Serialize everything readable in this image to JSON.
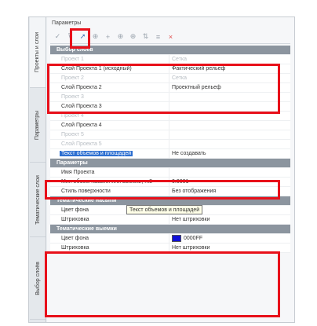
{
  "panel_title": "Параметры",
  "side_tabs": [
    "Проекты и слои",
    "Параметры",
    "Тематические слои",
    "Выбор слоёв"
  ],
  "toolbar_icons": [
    "check-icon",
    "filter-icon",
    "select-layer-icon",
    "crosshair-icon",
    "plus-icon",
    "target-icon",
    "target-add-icon",
    "sort-icon",
    "list-icon",
    "close-icon"
  ],
  "rows": [
    {
      "type": "cat",
      "key": "Выбор слоёв",
      "val": ""
    },
    {
      "type": "dim",
      "key": "Проект 1",
      "val": "Сетка"
    },
    {
      "type": "normal",
      "key": "Слой Проекта 1 (исходный)",
      "val": "Фактический рельеф"
    },
    {
      "type": "dim",
      "key": "Проект 2",
      "val": "Сетка"
    },
    {
      "type": "normal",
      "key": "Слой Проекта 2",
      "val": "Проектный рельеф"
    },
    {
      "type": "dim",
      "key": "Проект 3",
      "val": ""
    },
    {
      "type": "normal",
      "key": "Слой Проекта 3",
      "val": ""
    },
    {
      "type": "dim",
      "key": "Проект 4",
      "val": ""
    },
    {
      "type": "normal",
      "key": "Слой Проекта 4",
      "val": ""
    },
    {
      "type": "dim",
      "key": "Проект 5",
      "val": ""
    },
    {
      "type": "dim",
      "key": "Слой Проекта 5",
      "val": ""
    },
    {
      "type": "sel",
      "key": "Текст объемов и площадей",
      "val": "Не создавать"
    },
    {
      "type": "cat",
      "key": "Параметры",
      "val": ""
    },
    {
      "type": "normal",
      "key": "Имя Проекта",
      "val": ""
    },
    {
      "type": "normal",
      "key": "Мин объем насыпи или выемки, m3",
      "val": "0.0001"
    },
    {
      "type": "normal",
      "key": "Стиль поверхности",
      "val": "Без отображения"
    },
    {
      "type": "cat",
      "key": "Тематические насыпи",
      "val": ""
    },
    {
      "type": "color",
      "key": "Цвет фона",
      "val": "FF0000",
      "swatch": "#e01010"
    },
    {
      "type": "normal",
      "key": "Штриховка",
      "val": "Нет штриховки"
    },
    {
      "type": "cat",
      "key": "Тематические выемки",
      "val": ""
    },
    {
      "type": "color",
      "key": "Цвет фона",
      "val": "0000FF",
      "swatch": "#1010d8"
    },
    {
      "type": "normal",
      "key": "Штриховка",
      "val": "Нет штриховки"
    }
  ],
  "tooltip": "Текст объемов и площадей",
  "highlight_color": "#e8101a"
}
